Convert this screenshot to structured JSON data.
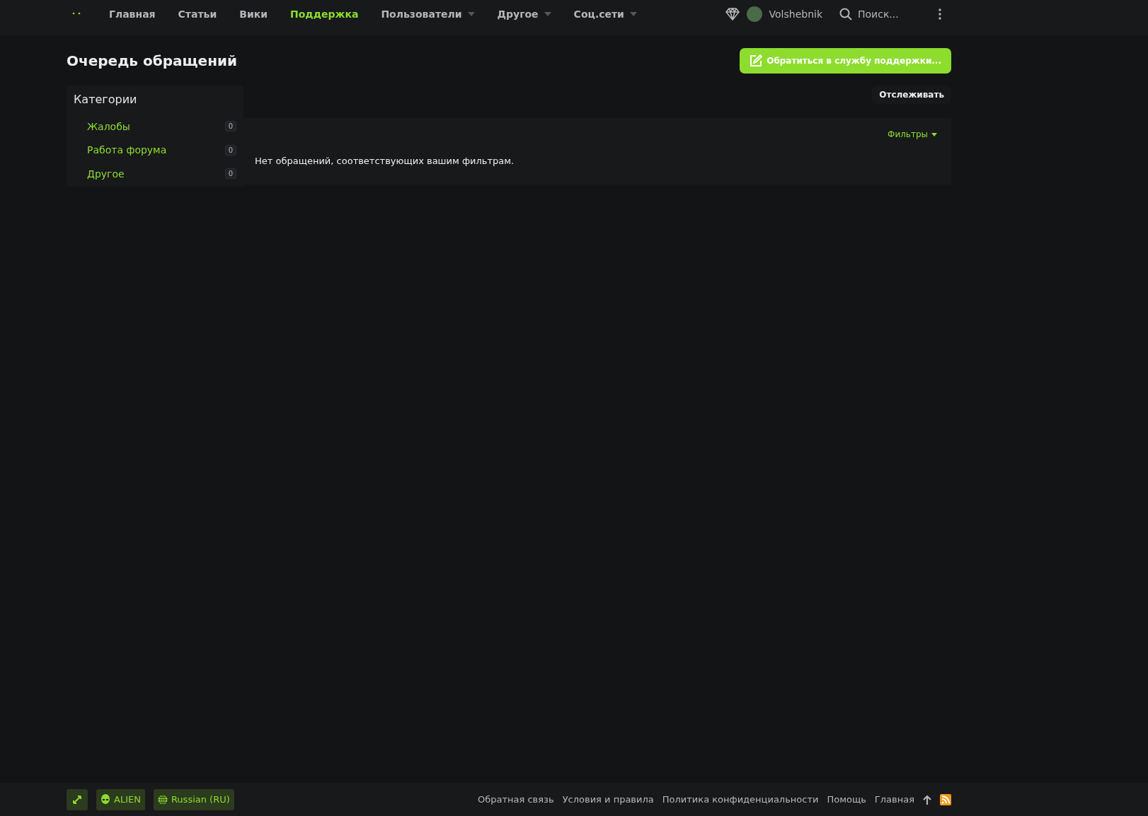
{
  "nav": {
    "items": [
      {
        "label": "Главная",
        "selected": false,
        "dropdown": false
      },
      {
        "label": "Статьи",
        "selected": false,
        "dropdown": false
      },
      {
        "label": "Вики",
        "selected": false,
        "dropdown": false
      },
      {
        "label": "Поддержка",
        "selected": true,
        "dropdown": false
      },
      {
        "label": "Пользователи",
        "selected": false,
        "dropdown": true
      },
      {
        "label": "Другое",
        "selected": false,
        "dropdown": true
      },
      {
        "label": "Соц.сети",
        "selected": false,
        "dropdown": true
      }
    ],
    "username": "Volshebnik",
    "search_placeholder": "Поиск..."
  },
  "page": {
    "title": "Очередь обращений",
    "primary_button": "Обратиться в службу поддержки...",
    "watch_button": "Отслеживать",
    "filters_button": "Фильтры",
    "empty_message": "Нет обращений, соответствующих вашим фильтрам."
  },
  "sidebar": {
    "title": "Категории",
    "items": [
      {
        "label": "Жалобы",
        "count": "0"
      },
      {
        "label": "Работа форума",
        "count": "0"
      },
      {
        "label": "Другое",
        "count": "0"
      }
    ]
  },
  "footer": {
    "style_button": "ALIEN",
    "language_button": "Russian (RU)",
    "links": [
      "Обратная связь",
      "Условия и правила",
      "Политика конфиденциальности",
      "Помощь",
      "Главная"
    ]
  }
}
